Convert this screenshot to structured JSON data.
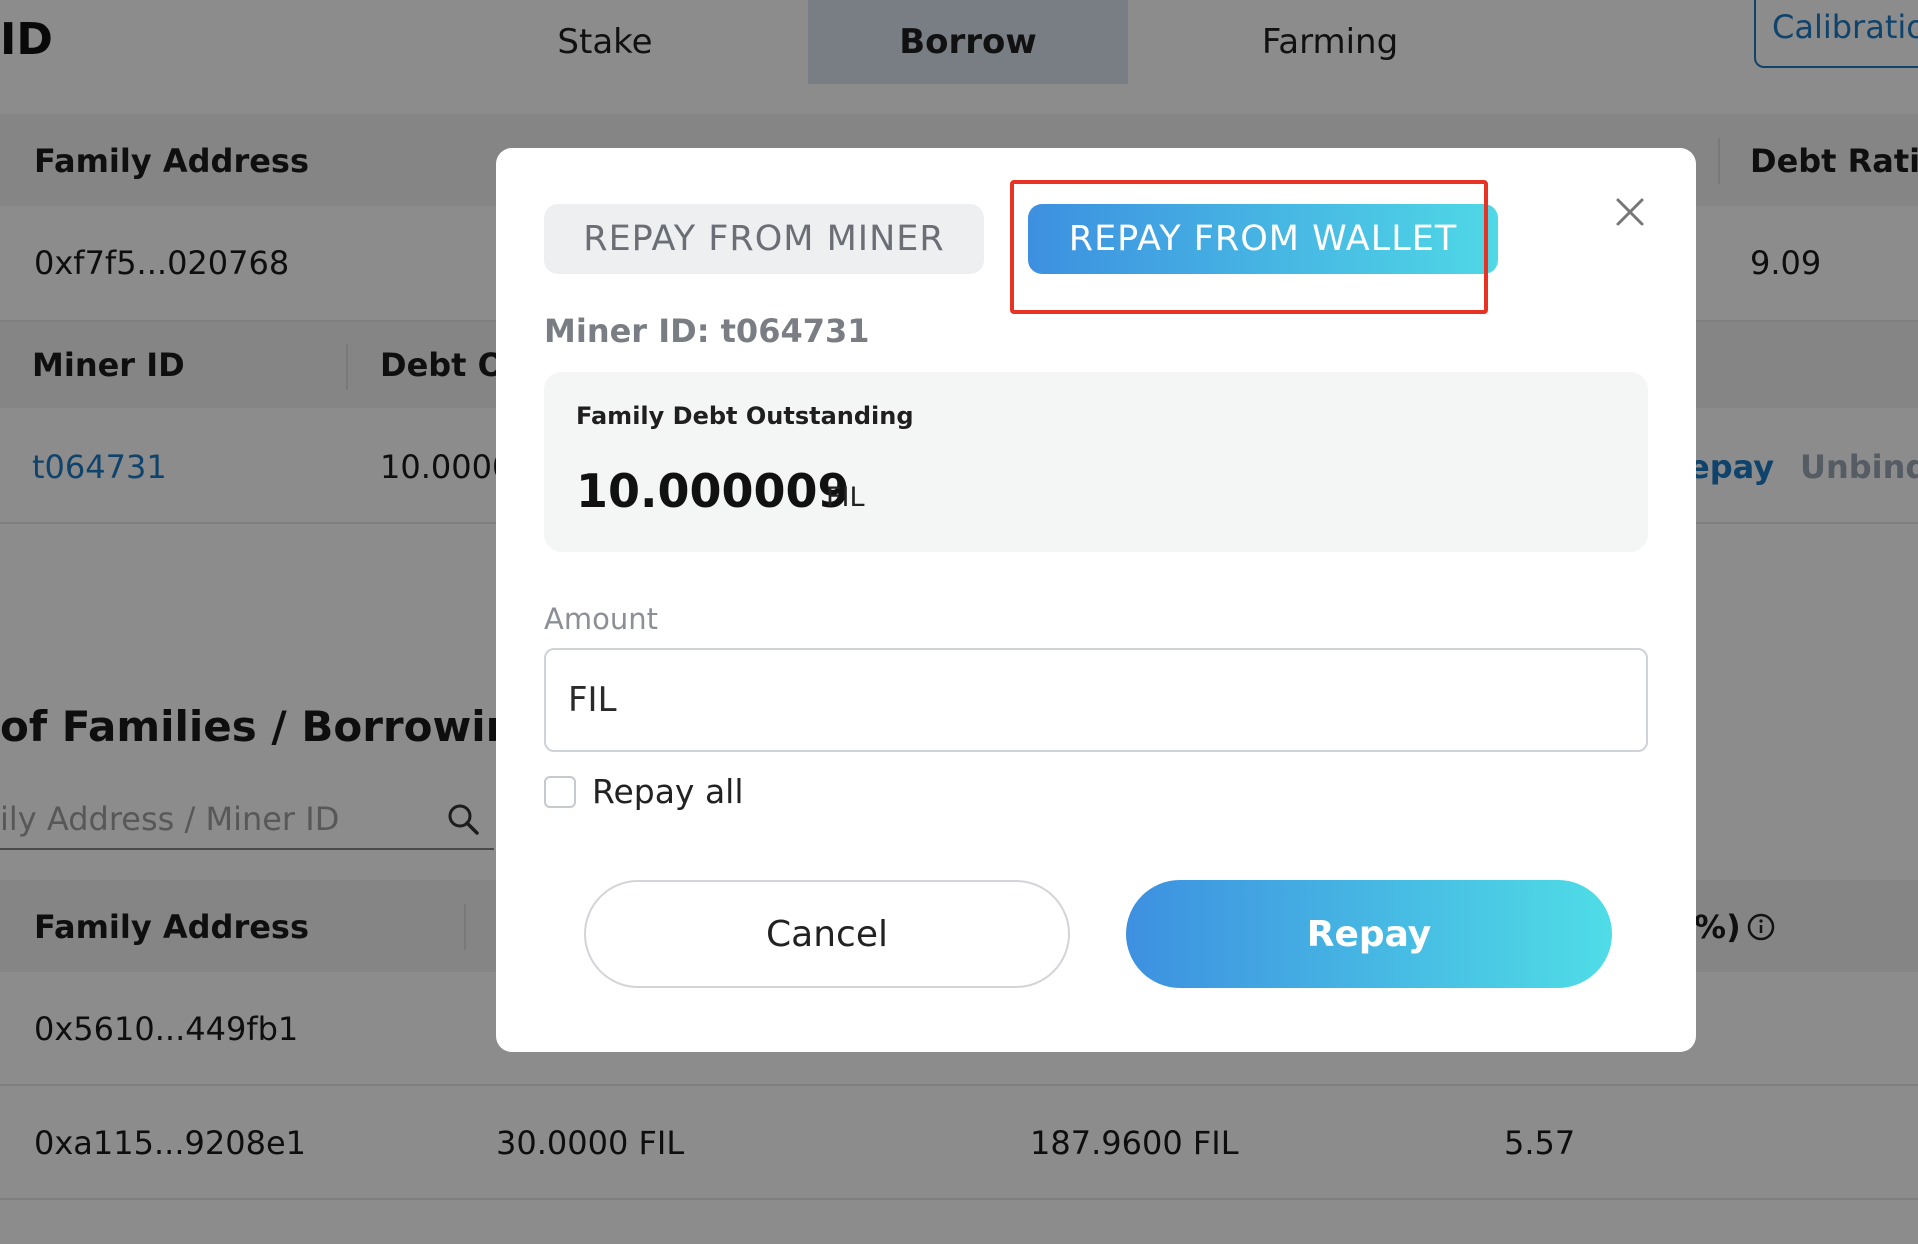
{
  "nav": {
    "brand": "ID",
    "tabs": [
      {
        "label": "Stake"
      },
      {
        "label": "Borrow"
      },
      {
        "label": "Farming"
      }
    ],
    "network_label": "Calibratio"
  },
  "family_table": {
    "headers": {
      "family_address": "Family Address",
      "debt_ratio": "Debt Ratic"
    },
    "row": {
      "family_address": "0xf7f5...020768",
      "debt_ratio": "9.09"
    }
  },
  "miner_table": {
    "headers": {
      "miner_id": "Miner ID",
      "debt": "Debt O"
    },
    "row": {
      "miner_id": "t064731",
      "debt": "10.0000",
      "repay_action": "epay",
      "unbind_action": "Unbind"
    }
  },
  "families_section": {
    "title": "of Families / Borrowings",
    "search_placeholder": "ily Address / Miner ID",
    "headers": {
      "family_address": "Family Address",
      "ratio": "%)"
    },
    "rows": [
      {
        "family_address": "0x5610...449fb1",
        "col2": "",
        "col3": "",
        "col4": ""
      },
      {
        "family_address": "0xa115...9208e1",
        "col2": "30.0000 FIL",
        "col3": "187.9600 FIL",
        "col4": "5.57"
      }
    ]
  },
  "modal": {
    "tab_miner": "REPAY FROM MINER",
    "tab_wallet": "REPAY FROM WALLET",
    "miner_id_label": "Miner ID: t064731",
    "debt_card": {
      "label": "Family Debt Outstanding",
      "value": "10.000009",
      "unit": "FIL"
    },
    "amount_label": "Amount",
    "amount_placeholder": "FIL",
    "repay_all_label": "Repay all",
    "cancel_label": "Cancel",
    "repay_label": "Repay"
  },
  "colors": {
    "accent_gradient_start": "#3d90e0",
    "accent_gradient_end": "#4fd8e6",
    "link": "#1e7bc4",
    "highlight": "#e83223"
  }
}
